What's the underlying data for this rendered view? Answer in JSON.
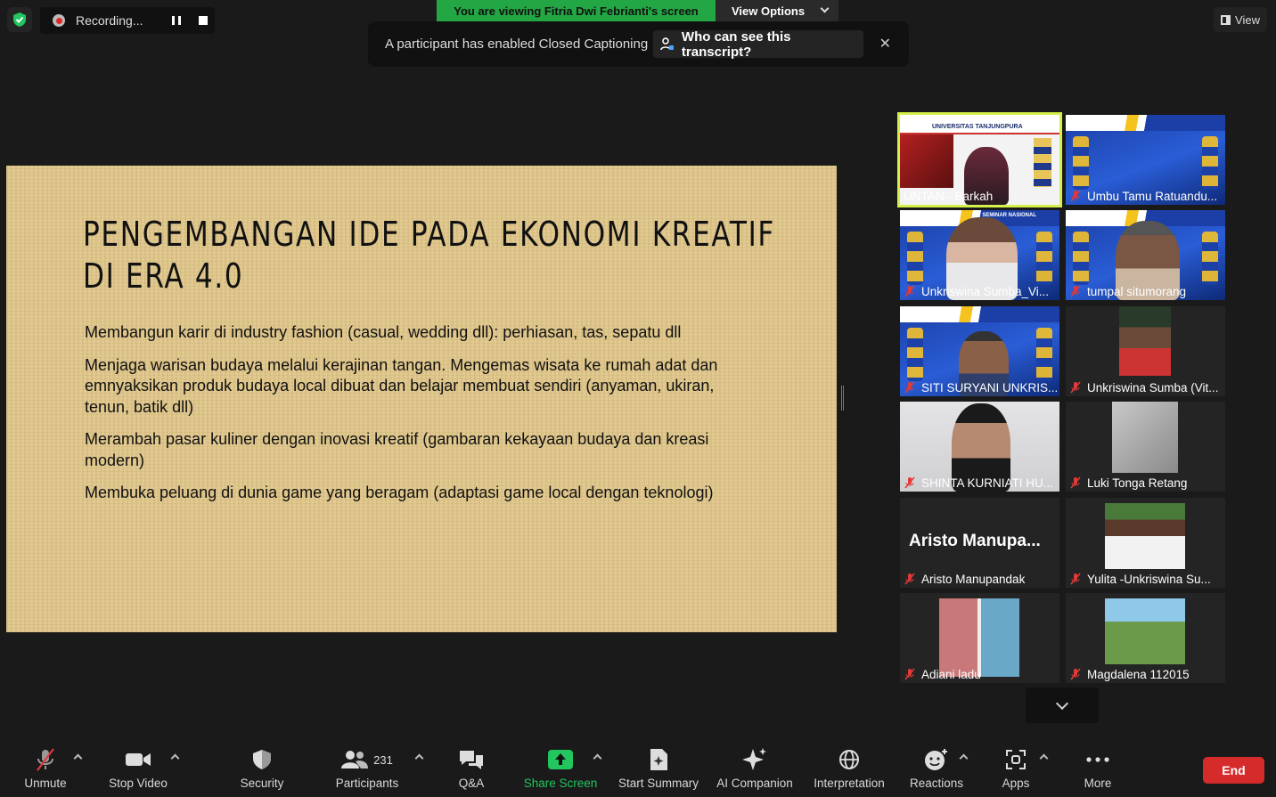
{
  "top": {
    "recording_label": "Recording...",
    "viewing_banner": "You are viewing Fitria Dwi Febrianti's screen",
    "view_options": "View Options",
    "view_button": "View"
  },
  "notification": {
    "message": "A participant has enabled Closed Captioning",
    "who_button": "Who can see this transcript?",
    "close": "✕"
  },
  "slide": {
    "title_line1": "PENGEMBANGAN IDE PADA EKONOMI KREATIF",
    "title_line2": "DI ERA 4.0",
    "bullets": [
      "Membangun karir di industry fashion (casual, wedding dll): perhiasan, tas, sepatu dll",
      "Menjaga warisan budaya melalui kerajinan tangan. Mengemas wisata ke rumah adat dan emnyaksikan produk budaya local dibuat dan belajar membuat sendiri (anyaman, ukiran, tenun, batik dll)",
      "Merambah pasar kuliner dengan inovasi kreatif (gambaran kekayaan budaya dan kreasi modern)",
      "Membuka peluang di dunia game yang beragam (adaptasi game local dengan teknologi)"
    ]
  },
  "gallery": {
    "participants": [
      {
        "name": "UNTAN - Barkah"
      },
      {
        "name": "Umbu Tamu Ratuandu..."
      },
      {
        "name": "Unkriswina Sumba_Vi..."
      },
      {
        "name": "tumpal situmorang"
      },
      {
        "name": "SITI SURYANI UNKRIS..."
      },
      {
        "name": "Unkriswina Sumba (Vit..."
      },
      {
        "name": "SHINTA KURNIATI HU..."
      },
      {
        "name": "Luki Tonga Retang"
      },
      {
        "name": "Aristo Manupandak",
        "display": "Aristo  Manupa..."
      },
      {
        "name": "Yulita -Unkriswina Su..."
      },
      {
        "name": "Adiani ladu"
      },
      {
        "name": "Magdalena 112015"
      }
    ],
    "poster_text": {
      "univ": "UNIVERSITAS TANJUNGPURA",
      "seminar": "SEMINAR NASIONAL"
    }
  },
  "toolbar": {
    "unmute": "Unmute",
    "stop_video": "Stop Video",
    "security": "Security",
    "participants": "Participants",
    "participants_count": "231",
    "qa": "Q&A",
    "share_screen": "Share Screen",
    "start_summary": "Start Summary",
    "ai_companion": "AI Companion",
    "interpretation": "Interpretation",
    "reactions": "Reactions",
    "apps": "Apps",
    "more": "More",
    "end": "End"
  },
  "colors": {
    "accent_green": "#23a744",
    "end_red": "#d52b2b",
    "active_speaker": "#d4f04a",
    "muted_red": "#e03a3a"
  }
}
